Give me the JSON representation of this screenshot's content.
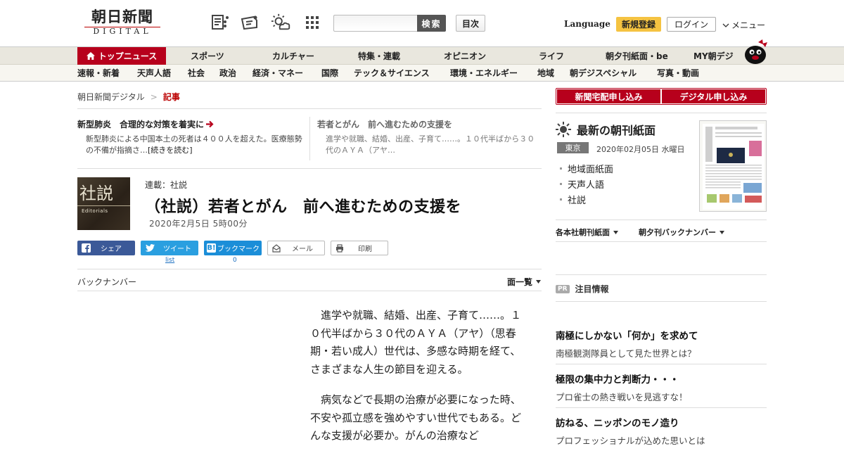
{
  "header": {
    "logo_jp": "朝日新聞",
    "logo_en": "DIGITAL",
    "search_placeholder": "",
    "search_button": "検索",
    "toc_button": "目次",
    "language": "Language",
    "signup": "新規登録",
    "login": "ログイン",
    "menu": "メニュー"
  },
  "nav_primary": [
    "トップニュース",
    "スポーツ",
    "カルチャー",
    "特集・連載",
    "オピニオン",
    "ライフ",
    "朝夕刊紙面・be",
    "MY朝デジ"
  ],
  "nav_secondary": [
    "速報・新着",
    "天声人語",
    "社会",
    "政治",
    "経済・マネー",
    "国際",
    "テック＆サイエンス",
    "環境・エネルギー",
    "地域",
    "朝デジスペシャル",
    "写真・動画"
  ],
  "breadcrumb": {
    "home": "朝日新聞デジタル",
    "separator": ">",
    "current": "記事"
  },
  "related": [
    {
      "title": "新型肺炎　合理的な対策を着実に",
      "desc": "新型肺炎による中国本土の死者は４００人を超えた。医療態勢の不備が指摘さ…",
      "more": "[続きを読む]"
    },
    {
      "title": "若者とがん　前へ進むための支援を",
      "desc": "進学や就職、結婚、出産、子育て……。１０代半ばから３０代のＡＹＡ（アヤ…"
    }
  ],
  "article": {
    "thumb_kanji": "社説",
    "thumb_en": "Editorials",
    "series": "連載：社説",
    "title": "（社説）若者とがん　前へ進むための支援を",
    "date": "2020年2月5日 5時00分",
    "share": {
      "facebook": "シェア",
      "twitter": "ツイート",
      "hatena": "ブックマーク",
      "mail": "メール",
      "print": "印刷",
      "twitter_count": "list",
      "hatena_count": "0"
    },
    "backnumber": "バックナンバー",
    "page_list": "面一覧",
    "paragraphs": [
      "進学や就職、結婚、出産、子育て……。１０代半ばから３０代のＡＹＡ（アヤ）（思春期・若い成人）世代は、多感な時期を経て、さまざまな人生の節目を迎える。",
      "病気などで長期の治療が必要になった時、不安や孤立感を強めやすい世代でもある。どんな支援が必要か。がんの治療など"
    ]
  },
  "sidebar": {
    "subscribe_paper": "新聞宅配申し込み",
    "subscribe_digital": "デジタル申し込み",
    "paper_heading": "最新の朝刊紙面",
    "region": "東京",
    "paper_date": "2020年02月05日 水曜日",
    "paper_links": [
      "地域面紙面",
      "天声人語",
      "社説"
    ],
    "dropdown_main": "各本社朝刊紙面",
    "dropdown_back": "朝夕刊バックナンバー",
    "pr_badge": "PR",
    "pr_heading": "注目情報",
    "ads": [
      {
        "title": "南極にしかない「何か」を求めて",
        "sub": "南極観測隊員として見た世界とは？"
      },
      {
        "title": "極限の集中力と判断力・・・",
        "sub": "プロ雀士の熱き戦いを見逃すな！"
      },
      {
        "title": "訪ねる、ニッポンのモノ造り",
        "sub": "プロフェッショナルが込めた思いとは"
      }
    ]
  },
  "colors": {
    "brand_red": "#b7001c",
    "signup_yellow": "#f5c341",
    "facebook": "#3b5998",
    "twitter": "#2a9fe0",
    "hatena": "#1b8ed8"
  }
}
